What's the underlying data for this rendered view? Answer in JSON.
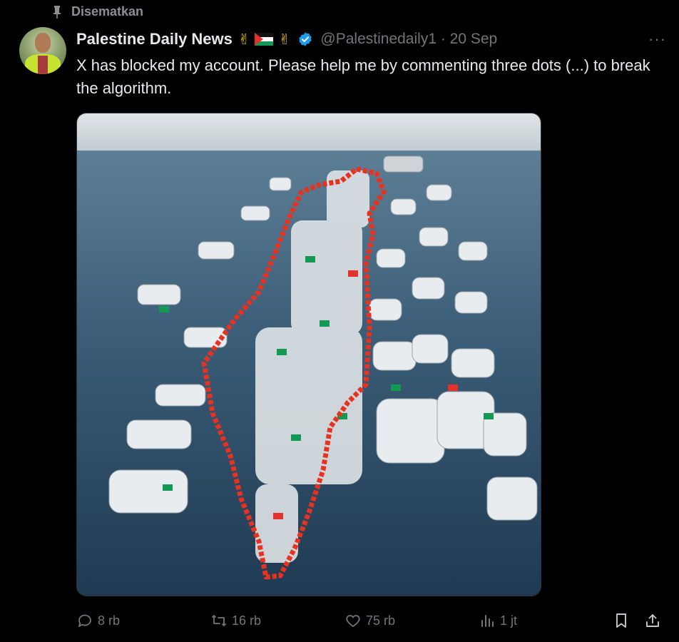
{
  "pinned": {
    "label": "Disematkan",
    "icon": "pin-icon"
  },
  "author": {
    "display_name": "Palestine Daily News",
    "handle_time": "@Palestinedaily1 · 20 Sep",
    "victory_emoji_1": "✌",
    "victory_emoji_2": "✌",
    "verified": true
  },
  "tweet": {
    "text": "X has blocked my account. Please help me by commenting three dots (...) to break the algorithm."
  },
  "more_label": "···",
  "actions": {
    "replies": "8 rb",
    "reposts": "16 rb",
    "likes": "75 rb",
    "views": "1 jt"
  },
  "colors": {
    "background": "#000000",
    "text": "#e7e9ea",
    "muted": "#71767b",
    "verified_blue": "#1d9bf0"
  }
}
